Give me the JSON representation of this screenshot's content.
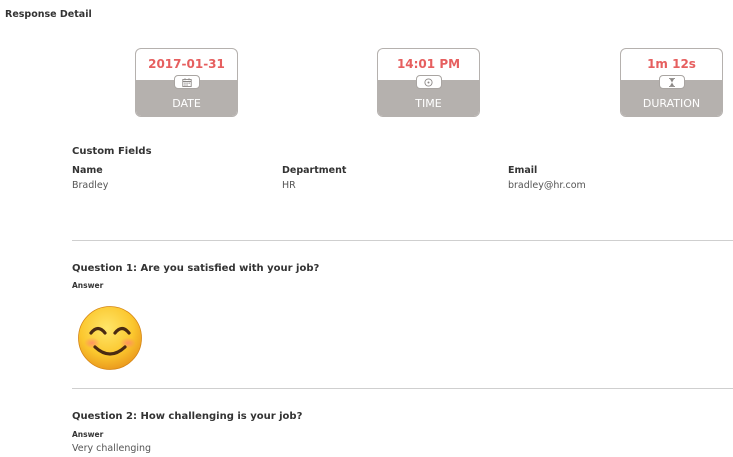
{
  "page": {
    "title": "Response Detail"
  },
  "stats": [
    {
      "value": "2017-01-31",
      "label": "DATE",
      "icon": "calendar-icon"
    },
    {
      "value": "14:01 PM",
      "label": "TIME",
      "icon": "clock-icon"
    },
    {
      "value": "1m 12s",
      "label": "DURATION",
      "icon": "hourglass-icon"
    }
  ],
  "custom_fields": {
    "title": "Custom Fields",
    "columns": [
      {
        "label": "Name",
        "value": "Bradley"
      },
      {
        "label": "Department",
        "value": "HR"
      },
      {
        "label": "Email",
        "value": "bradley@hr.com"
      }
    ]
  },
  "questions": [
    {
      "title": "Question 1: Are you satisfied with your job?",
      "answer_label": "Answer",
      "answer_emoji": "smiling-face-icon"
    },
    {
      "title": "Question 2: How challenging is your job?",
      "answer_label": "Answer",
      "answer_text": "Very challenging"
    }
  ],
  "colors": {
    "accent": "#e65f5f",
    "card_band": "#b5b1ae",
    "divider": "#cfcfcf"
  }
}
